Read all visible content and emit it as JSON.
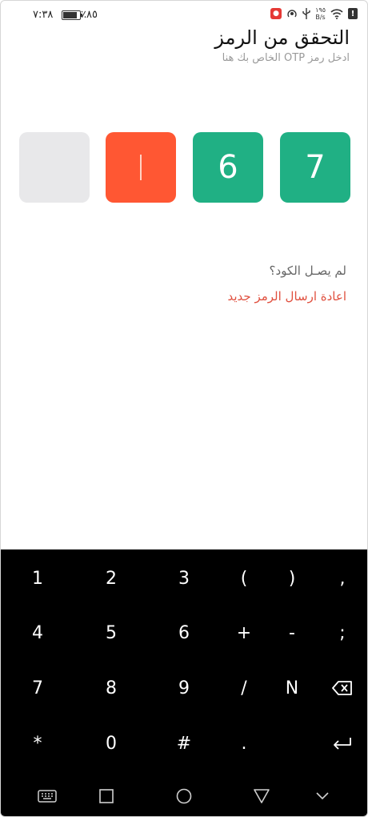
{
  "status_bar": {
    "time": "٧:٣٨",
    "battery_pct": "٪٨٥",
    "battery_level": 0.85,
    "net_speed_value": "١٩٥",
    "net_speed_unit": "B/s",
    "icons": [
      "alert-icon",
      "wifi-icon",
      "usb-icon",
      "hotspot-icon",
      "map-icon"
    ]
  },
  "header": {
    "title": "التحقق من الرمز",
    "subtitle": "ادخل رمز OTP الخاص بك هنا"
  },
  "otp": {
    "digits": [
      "",
      "",
      "6",
      "7"
    ],
    "states": [
      "empty",
      "active",
      "filled",
      "filled"
    ]
  },
  "resend": {
    "question": "لم يصـل الكود؟",
    "link": "اعادة ارسال الرمز جديد"
  },
  "keyboard": {
    "rows": [
      [
        "1",
        "2",
        "3",
        "(",
        ")",
        ","
      ],
      [
        "4",
        "5",
        "6",
        "+",
        "-",
        ";"
      ],
      [
        "7",
        "8",
        "9",
        "/",
        "N",
        "backspace"
      ],
      [
        "*",
        "0",
        "#",
        ".",
        "",
        "enter"
      ]
    ]
  },
  "navbar": [
    "keyboard-toggle-icon",
    "recents-icon",
    "home-icon",
    "back-icon",
    "hide-keyboard-icon"
  ],
  "colors": {
    "filled": "#20b084",
    "active": "#ff5733",
    "empty": "#e8e8ea",
    "link": "#e0503f"
  }
}
